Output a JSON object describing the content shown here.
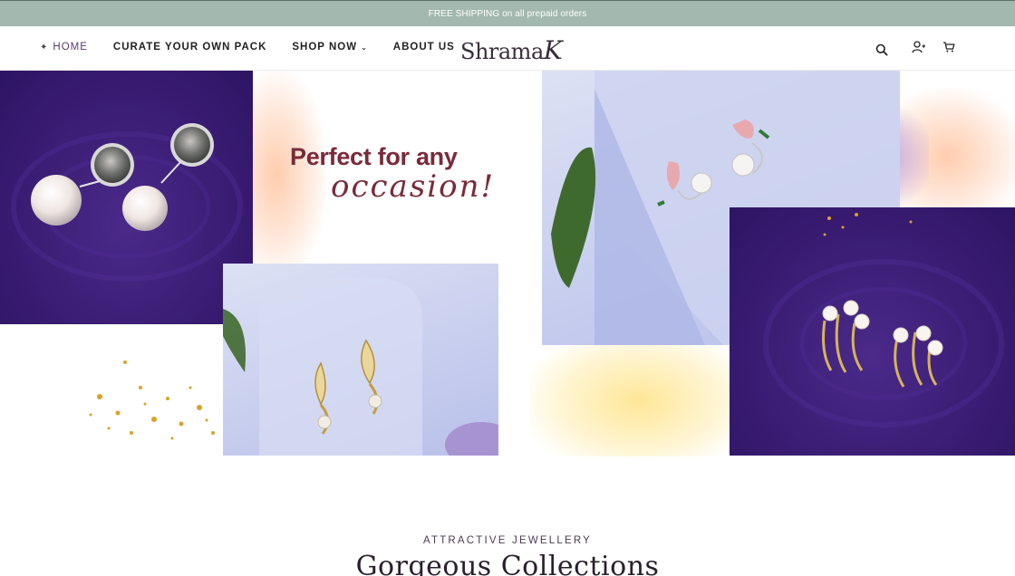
{
  "announcement": {
    "text": "FREE SHIPPING on all prepaid orders"
  },
  "header": {
    "nav": [
      {
        "label": "HOME",
        "active": true,
        "icon": "sparkle-icon"
      },
      {
        "label": "CURATE YOUR OWN PACK"
      },
      {
        "label": "SHOP NOW",
        "has_dropdown": true,
        "icon": "chevron-down-icon"
      },
      {
        "label": "ABOUT US"
      }
    ],
    "logo_main": "Shrama",
    "logo_end": "K",
    "icons": [
      "search-icon",
      "account-icon",
      "cart-icon"
    ]
  },
  "hero": {
    "headline": "Perfect for any",
    "script": "occasion!",
    "colors": {
      "purple": "#3d1f78",
      "lavender": "#c6cdee",
      "maroon": "#7a2a3a",
      "gold": "#d9a22a"
    }
  },
  "section": {
    "subtitle": "ATTRACTIVE JEWELLERY",
    "title": "Gorgeous Collections"
  }
}
